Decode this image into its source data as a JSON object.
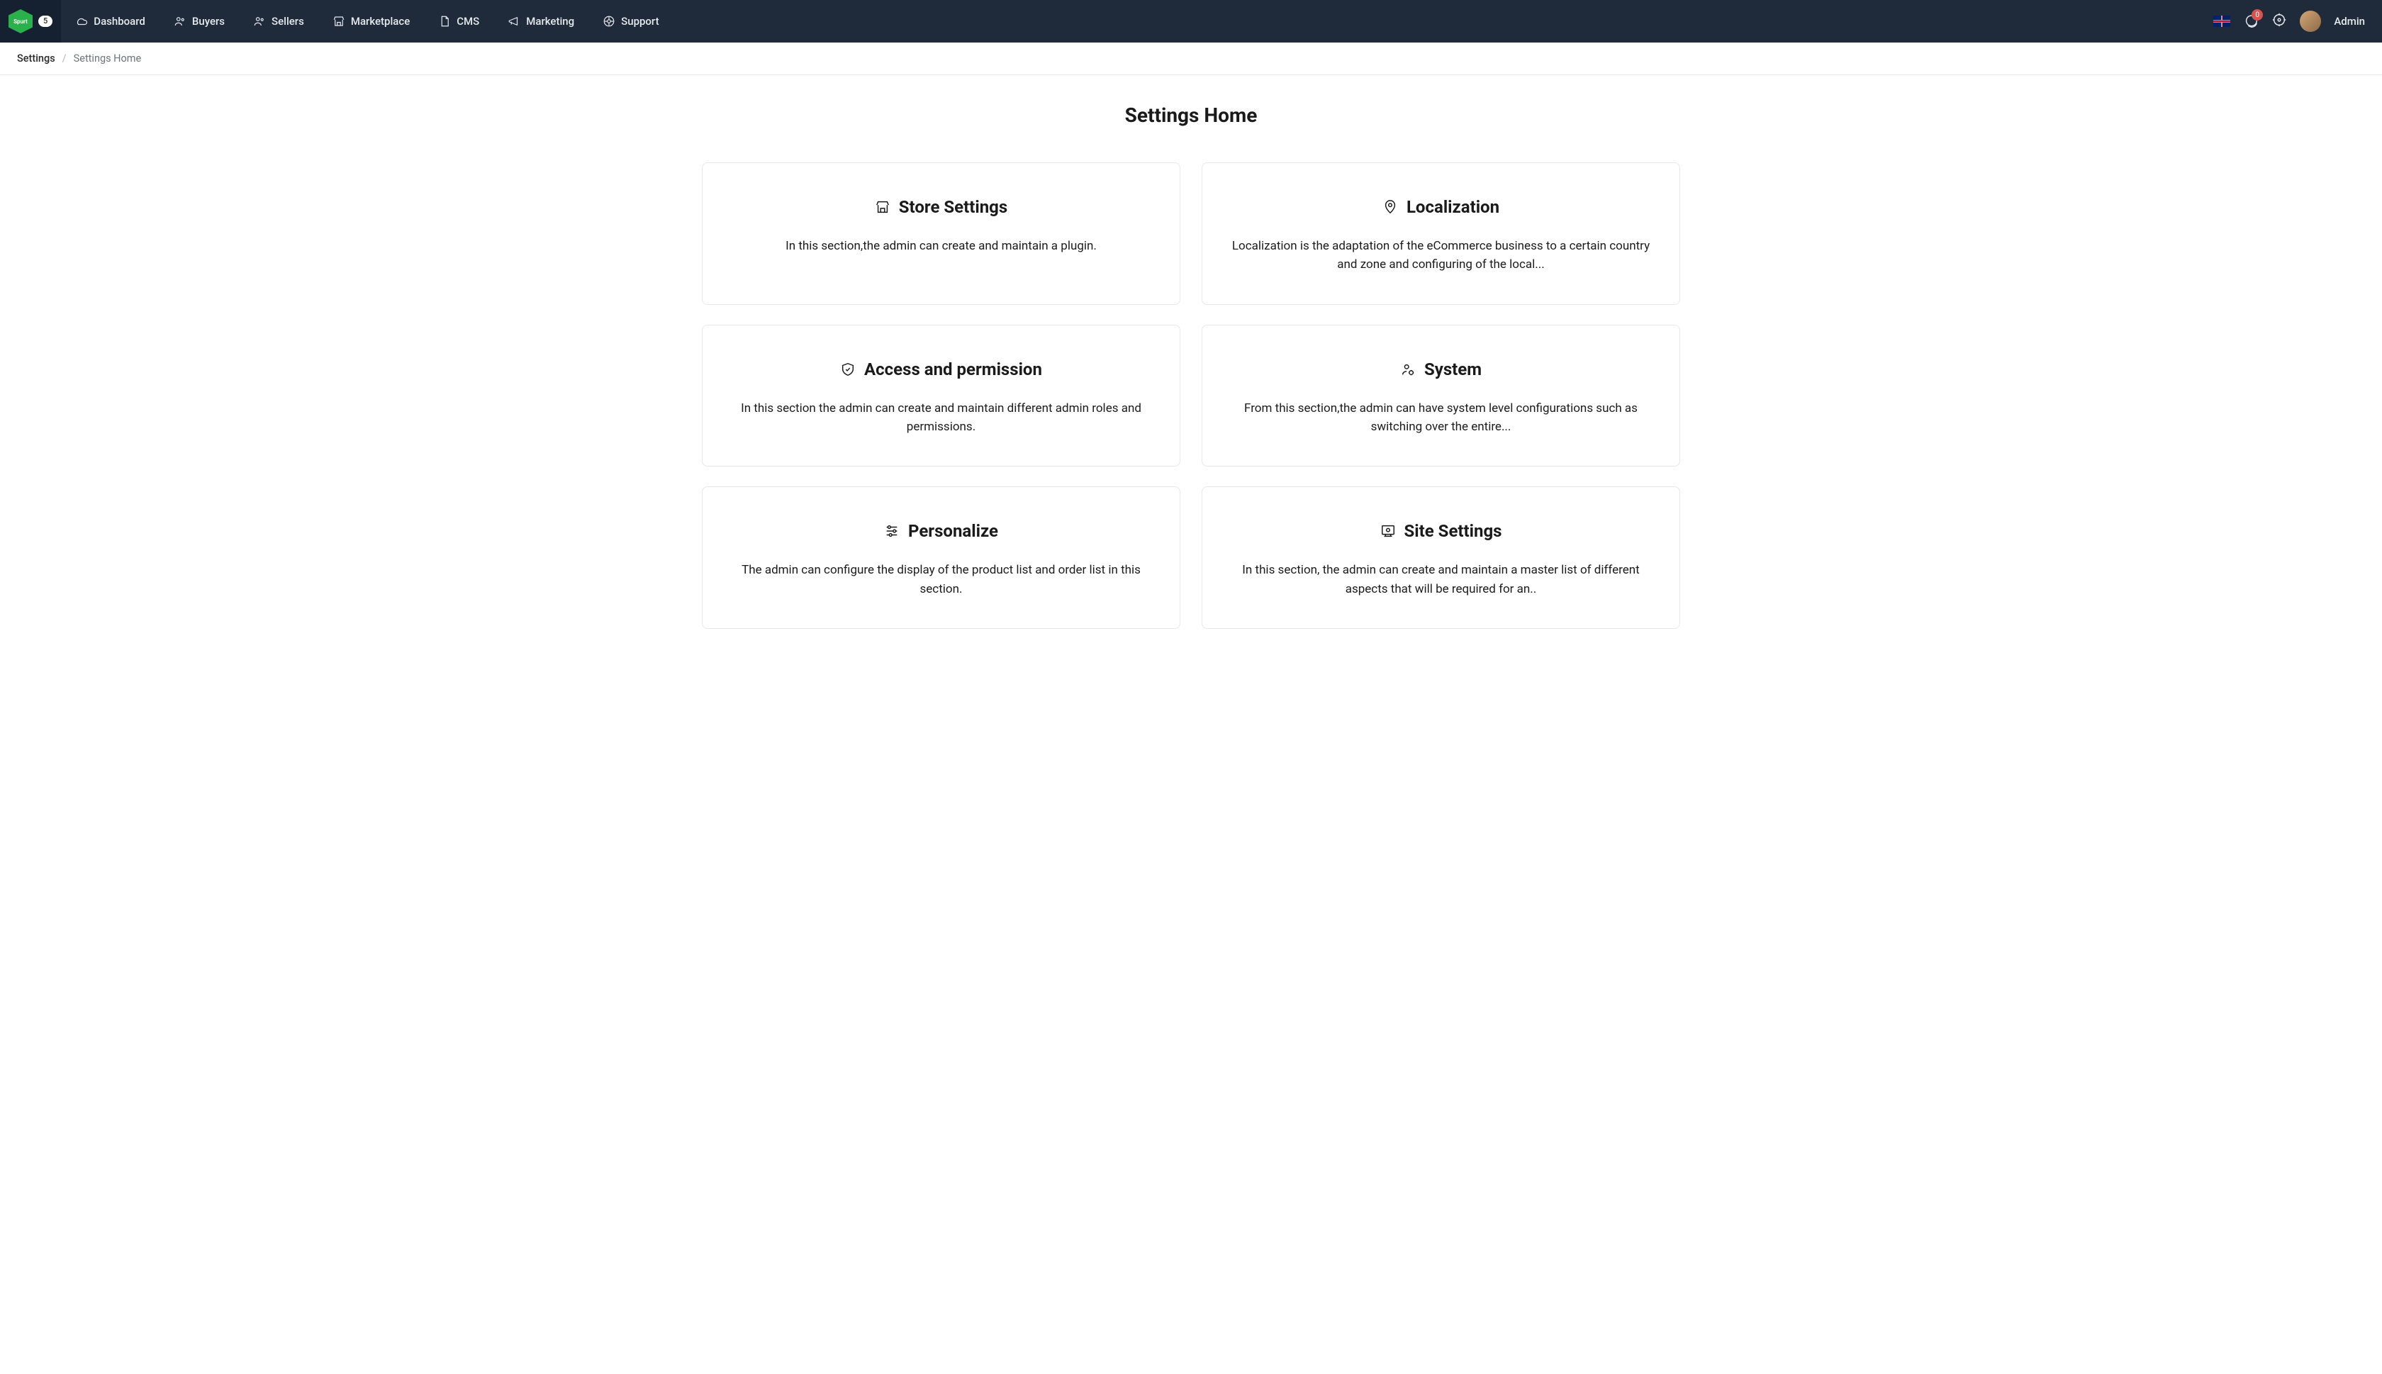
{
  "header": {
    "logo_text": "Spurt",
    "logo_badge": "5",
    "nav": [
      {
        "icon": "dashboard",
        "label": "Dashboard"
      },
      {
        "icon": "buyers",
        "label": "Buyers"
      },
      {
        "icon": "sellers",
        "label": "Sellers"
      },
      {
        "icon": "marketplace",
        "label": "Marketplace"
      },
      {
        "icon": "cms",
        "label": "CMS"
      },
      {
        "icon": "marketing",
        "label": "Marketing"
      },
      {
        "icon": "support",
        "label": "Support"
      }
    ],
    "chat_badge": "0",
    "user_name": "Admin"
  },
  "breadcrumb": {
    "root": "Settings",
    "current": "Settings Home"
  },
  "page": {
    "title": "Settings Home"
  },
  "cards": [
    {
      "icon": "store",
      "title": "Store Settings",
      "desc": "In this section,the admin can create and maintain a plugin."
    },
    {
      "icon": "pin",
      "title": "Localization",
      "desc": "Localization is the adaptation of the eCommerce business to a certain country and zone and configuring of the local..."
    },
    {
      "icon": "shield",
      "title": "Access and permission",
      "desc": "In this section the admin can create and maintain different admin roles and permissions."
    },
    {
      "icon": "user-gear",
      "title": "System",
      "desc": "From this section,the admin can have system level configurations such as switching over the entire..."
    },
    {
      "icon": "sliders",
      "title": "Personalize",
      "desc": "The admin can configure the display of the product list and order list in this section."
    },
    {
      "icon": "monitor",
      "title": "Site Settings",
      "desc": "In this section, the admin can create and maintain a master list of different aspects that will be required for an.."
    }
  ]
}
